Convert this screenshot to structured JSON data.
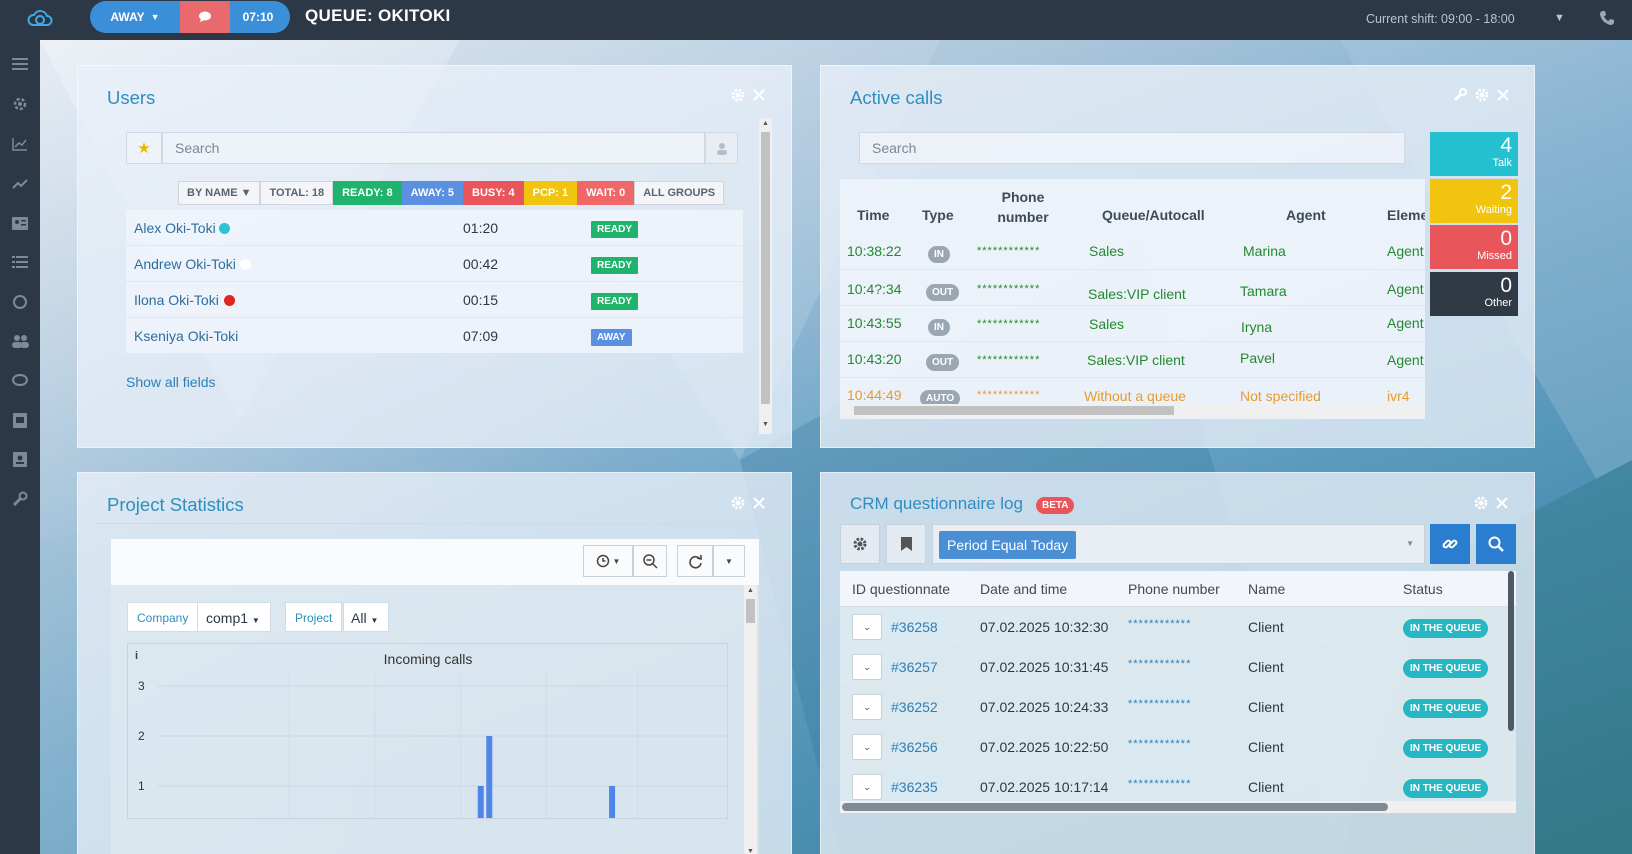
{
  "topbar": {
    "status": "AWAY",
    "timer": "07:10",
    "queue_title": "QUEUE: OKITOKI",
    "shift": "Current shift: 09:00 - 18:00",
    "colors": {
      "bar": "#2c3846",
      "accent": "#3a8fd8",
      "chat": "#e96a6c"
    }
  },
  "sidebar": {
    "icons": [
      "menu-icon",
      "settings-icon",
      "analytics-icon",
      "trend-icon",
      "contact-card-icon",
      "list-icon",
      "circle-icon",
      "users-icon",
      "chat-icon",
      "phone-book-icon",
      "contacts-icon",
      "wrench-icon"
    ]
  },
  "users": {
    "title": "Users",
    "search_placeholder": "Search",
    "filters": {
      "by_name": "BY NAME ▼",
      "total": "TOTAL: 18",
      "ready": "READY: 8",
      "away": "AWAY: 5",
      "busy": "BUSY: 4",
      "pcp": "PCP: 1",
      "wait": "WAIT: 0",
      "all_groups": "ALL GROUPS"
    },
    "rows": [
      {
        "name": "Alex Oki-Toki",
        "time": "01:20",
        "status": "READY",
        "dot": "#29c4d6"
      },
      {
        "name": "Andrew Oki-Toki",
        "time": "00:42",
        "status": "READY",
        "dot": "#ffffff"
      },
      {
        "name": "Ilona Oki-Toki",
        "time": "00:15",
        "status": "READY",
        "dot": "#e0241f"
      },
      {
        "name": "Kseniya Oki-Toki",
        "time": "07:09",
        "status": "AWAY",
        "dot": ""
      }
    ],
    "show_all": "Show all fields"
  },
  "active_calls": {
    "title": "Active calls",
    "search_placeholder": "Search",
    "headers": {
      "time": "Time",
      "type": "Type",
      "phone": "Phone number",
      "queue": "Queue/Autocall",
      "agent": "Agent",
      "element": "Eleme"
    },
    "rows": [
      {
        "time": "10:38:22",
        "type": "IN",
        "phone": "************",
        "queue": "Sales",
        "agent": "Marina",
        "element": "Agent",
        "color": "#23892d"
      },
      {
        "time": "10:4?:34",
        "type": "OUT",
        "phone": "************",
        "queue": "Sales:VIP client",
        "agent": "Tamara",
        "element": "Agent",
        "color": "#23892d"
      },
      {
        "time": "10:43:55",
        "type": "IN",
        "phone": "************",
        "queue": "Sales",
        "agent": "Iryna",
        "element": "Agent",
        "color": "#23892d"
      },
      {
        "time": "10:43:20",
        "type": "OUT",
        "phone": "************",
        "queue": "Sales:VIP client",
        "agent": "Pavel",
        "element": "Agent",
        "color": "#23892d"
      },
      {
        "time": "10:44:49",
        "type": "AUTO",
        "phone": "************",
        "queue": "Without a queue",
        "agent": "Not specified",
        "element": "ivr4",
        "color": "#e89b2a"
      }
    ],
    "tiles": [
      {
        "num": "4",
        "label": "Talk",
        "color": "#26c1d1"
      },
      {
        "num": "2",
        "label": "Waiting",
        "color": "#f1c40f"
      },
      {
        "num": "0",
        "label": "Missed",
        "color": "#e8555a"
      },
      {
        "num": "0",
        "label": "Other",
        "color": "#2f3a45"
      }
    ]
  },
  "project_stats": {
    "title": "Project Statistics",
    "company_label": "Company",
    "company_value": "comp1",
    "project_label": "Project",
    "project_value": "All",
    "info": "i"
  },
  "chart_data": {
    "type": "bar",
    "title": "Incoming calls",
    "ylim": [
      0,
      3
    ],
    "yticks": [
      "3",
      "2",
      "1"
    ],
    "bars": [
      {
        "x": 0.63,
        "value": 1
      },
      {
        "x": 0.645,
        "value": 2
      },
      {
        "x": 0.86,
        "value": 1
      }
    ],
    "color": "#4f86e8"
  },
  "crm": {
    "title": "CRM questionnaire log",
    "beta": "BETA",
    "filter_chip": "Period Equal Today",
    "headers": {
      "id": "ID questionnate",
      "date": "Date and time",
      "phone": "Phone number",
      "name": "Name",
      "status": "Status"
    },
    "rows": [
      {
        "id": "#36258",
        "date": "07.02.2025 10:32:30",
        "phone": "************",
        "name": "Client",
        "status": "IN THE QUEUE"
      },
      {
        "id": "#36257",
        "date": "07.02.2025 10:31:45",
        "phone": "************",
        "name": "Client",
        "status": "IN THE QUEUE"
      },
      {
        "id": "#36252",
        "date": "07.02.2025 10:24:33",
        "phone": "************",
        "name": "Client",
        "status": "IN THE QUEUE"
      },
      {
        "id": "#36256",
        "date": "07.02.2025 10:22:50",
        "phone": "************",
        "name": "Client",
        "status": "IN THE QUEUE"
      },
      {
        "id": "#36235",
        "date": "07.02.2025 10:17:14",
        "phone": "************",
        "name": "Client",
        "status": "IN THE QUEUE"
      }
    ]
  }
}
